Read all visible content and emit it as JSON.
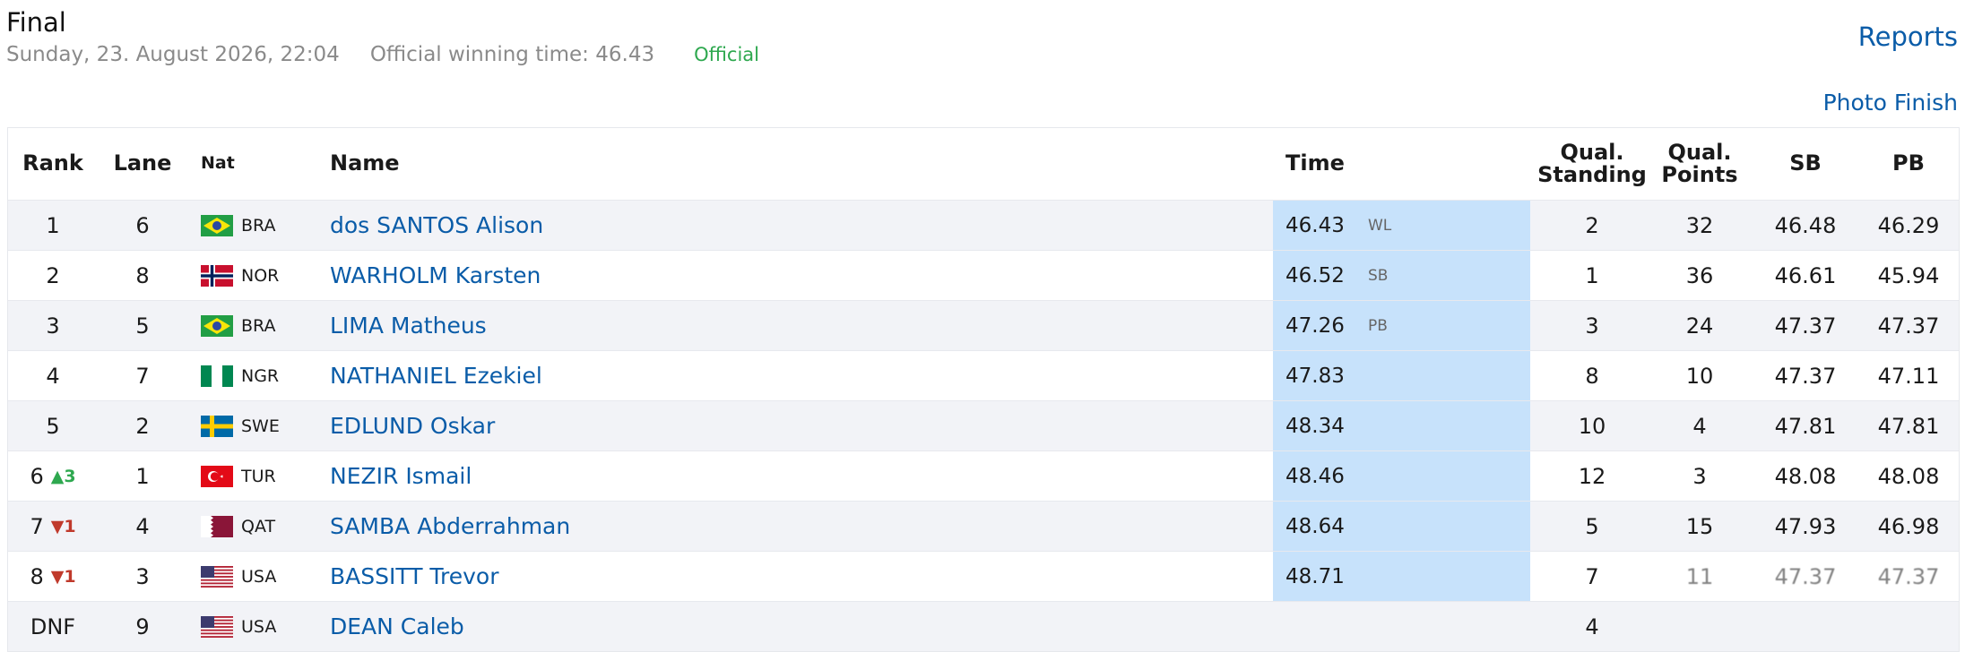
{
  "event": {
    "title": "Final",
    "datetime": "Sunday, 23. August 2026, 22:04",
    "winning_time": "Official winning time: 46.43",
    "status": "Official"
  },
  "links": {
    "reports": "Reports",
    "photo_finish": "Photo Finish"
  },
  "columns": {
    "rank": "Rank",
    "lane": "Lane",
    "nat": "Nat",
    "name": "Name",
    "time": "Time",
    "qual_standing": "Qual.\nStanding",
    "qual_points": "Qual.\nPoints",
    "sb": "SB",
    "pb": "PB"
  },
  "colors": {
    "link": "#0a5ca8",
    "time_highlight": "#c7e2fb",
    "up": "#2ea84f",
    "down": "#c0392b",
    "official": "#2ea84f"
  },
  "rows": [
    {
      "rank": "1",
      "change": "",
      "dir": "",
      "lane": "6",
      "nat": "BRA",
      "name": "dos SANTOS Alison",
      "time": "46.43",
      "mark": "WL",
      "qs": "2",
      "qp": "32",
      "sb": "46.48",
      "pb": "46.29"
    },
    {
      "rank": "2",
      "change": "",
      "dir": "",
      "lane": "8",
      "nat": "NOR",
      "name": "WARHOLM Karsten",
      "time": "46.52",
      "mark": "SB",
      "qs": "1",
      "qp": "36",
      "sb": "46.61",
      "pb": "45.94"
    },
    {
      "rank": "3",
      "change": "",
      "dir": "",
      "lane": "5",
      "nat": "BRA",
      "name": "LIMA Matheus",
      "time": "47.26",
      "mark": "PB",
      "qs": "3",
      "qp": "24",
      "sb": "47.37",
      "pb": "47.37"
    },
    {
      "rank": "4",
      "change": "",
      "dir": "",
      "lane": "7",
      "nat": "NGR",
      "name": "NATHANIEL Ezekiel",
      "time": "47.83",
      "mark": "",
      "qs": "8",
      "qp": "10",
      "sb": "47.37",
      "pb": "47.11"
    },
    {
      "rank": "5",
      "change": "",
      "dir": "",
      "lane": "2",
      "nat": "SWE",
      "name": "EDLUND Oskar",
      "time": "48.34",
      "mark": "",
      "qs": "10",
      "qp": "4",
      "sb": "47.81",
      "pb": "47.81"
    },
    {
      "rank": "6",
      "change": "▲3",
      "dir": "up",
      "lane": "1",
      "nat": "TUR",
      "name": "NEZIR Ismail",
      "time": "48.46",
      "mark": "",
      "qs": "12",
      "qp": "3",
      "sb": "48.08",
      "pb": "48.08"
    },
    {
      "rank": "7",
      "change": "▼1",
      "dir": "down",
      "lane": "4",
      "nat": "QAT",
      "name": "SAMBA Abderrahman",
      "time": "48.64",
      "mark": "",
      "qs": "5",
      "qp": "15",
      "sb": "47.93",
      "pb": "46.98"
    },
    {
      "rank": "8",
      "change": "▼1",
      "dir": "down",
      "lane": "3",
      "nat": "USA",
      "name": "BASSITT Trevor",
      "time": "48.71",
      "mark": "",
      "qs": "7",
      "qp": "11",
      "sb": "47.37",
      "pb": "47.37"
    },
    {
      "rank": "DNF",
      "change": "",
      "dir": "",
      "lane": "9",
      "nat": "USA",
      "name": "DEAN Caleb",
      "time": "",
      "mark": "",
      "qs": "4",
      "qp": "",
      "sb": "",
      "pb": ""
    }
  ]
}
